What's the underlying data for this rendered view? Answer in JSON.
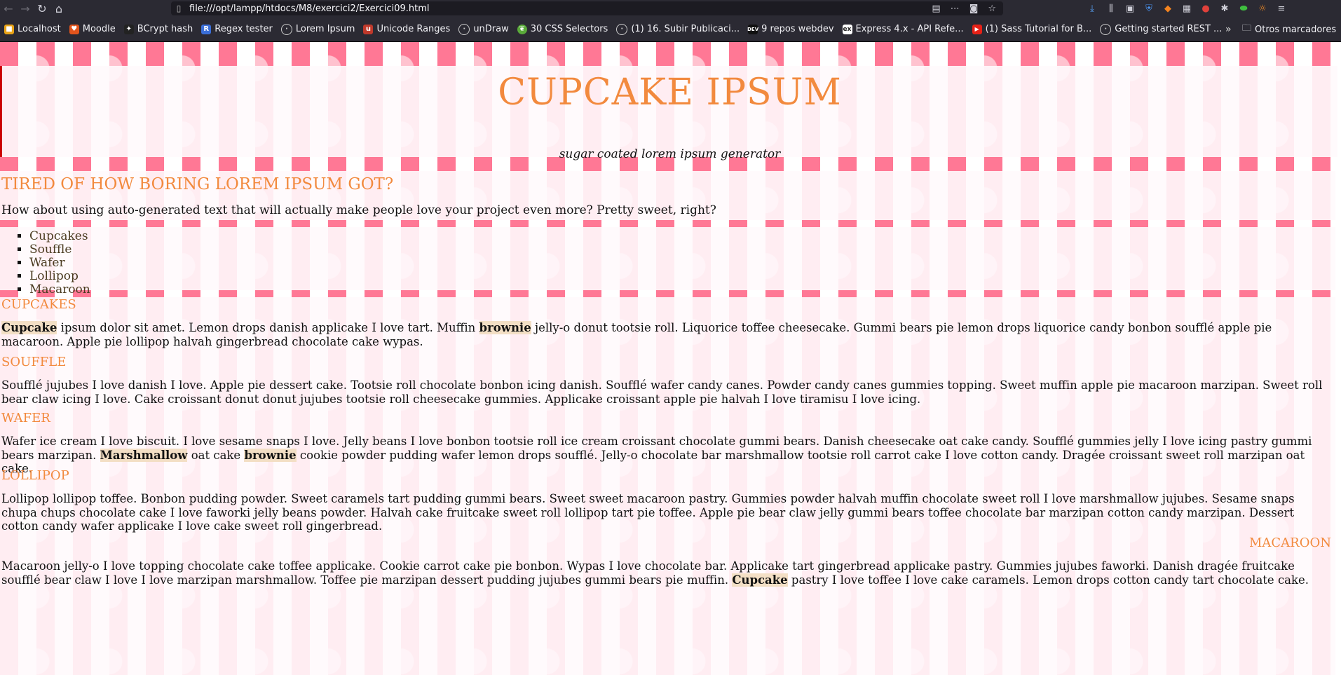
{
  "browser": {
    "url": "file:///opt/lampp/htdocs/M8/exercici2/Exercici09.html",
    "bookmarks": [
      {
        "label": "Localhost",
        "color": "#e8a317"
      },
      {
        "label": "Moodle",
        "color": "#e2541c"
      },
      {
        "label": "BCrypt hash",
        "color": "#222222"
      },
      {
        "label": "Regex tester",
        "color": "#3b6fd8"
      },
      {
        "label": "Lorem Ipsum",
        "color": "#888888"
      },
      {
        "label": "Unicode Ranges",
        "color": "#c0392b"
      },
      {
        "label": "unDraw",
        "color": "#888888"
      },
      {
        "label": "30 CSS Selectors",
        "color": "#5aaa3a"
      },
      {
        "label": "(1) 16. Subir Publicaci...",
        "color": "#888888"
      },
      {
        "label": "9 repos webdev",
        "color": "#111111"
      },
      {
        "label": "Express 4.x - API Refe...",
        "color": "#333333"
      },
      {
        "label": "(1) Sass Tutorial for B...",
        "color": "#e62117"
      },
      {
        "label": "Getting started REST ...",
        "color": "#888888"
      }
    ],
    "more_label": "»",
    "other_bookmarks": "Otros marcadores"
  },
  "page": {
    "title": "CUPCAKE IPSUM",
    "tagline": "sugar coated lorem ipsum generator",
    "intro_heading": "TIRED OF HOW BORING LOREM IPSUM GOT?",
    "intro_text": "How about using auto-generated text that will actually make people love your project even more? Pretty sweet, right?",
    "list": [
      "Cupcakes",
      "Souffle",
      "Wafer",
      "Lollipop",
      "Macaroon"
    ],
    "sections": {
      "cupcakes": {
        "heading": "CUPCAKES",
        "hl1": "Cupcake",
        "t1": " ipsum dolor sit amet. Lemon drops danish applicake I love tart. Muffin ",
        "hl2": "brownie",
        "t2": " jelly-o donut tootsie roll. Liquorice toffee cheesecake. Gummi bears pie lemon drops liquorice candy bonbon soufflé apple pie macaroon. Apple pie lollipop halvah gingerbread chocolate cake wypas."
      },
      "souffle": {
        "heading": "SOUFFLE",
        "text": "Soufflé jujubes I love danish I love. Apple pie dessert cake. Tootsie roll chocolate bonbon icing danish. Soufflé wafer candy canes. Powder candy canes gummies topping. Sweet muffin apple pie macaroon marzipan. Sweet roll bear claw icing I love. Cake croissant donut donut jujubes tootsie roll cheesecake gummies. Applicake croissant apple pie halvah I love tiramisu I love icing."
      },
      "wafer": {
        "heading": "WAFER",
        "t1": "Wafer ice cream I love biscuit. I love sesame snaps I love. Jelly beans I love bonbon tootsie roll ice cream croissant chocolate gummi bears. Danish cheesecake oat cake candy. Soufflé gummies jelly I love icing pastry gummi bears marzipan. ",
        "hl1": "Marshmallow",
        "t2": " oat cake ",
        "hl2": "brownie",
        "t3": " cookie powder pudding wafer lemon drops soufflé. Jelly-o chocolate bar marshmallow tootsie roll carrot cake I love cotton candy. Dragée croissant sweet roll marzipan oat cake."
      },
      "lollipop": {
        "heading": "LOLLIPOP",
        "text": "Lollipop lollipop toffee. Bonbon pudding powder. Sweet caramels tart pudding gummi bears. Sweet sweet macaroon pastry. Gummies powder halvah muffin chocolate sweet roll I love marshmallow jujubes. Sesame snaps chupa chups chocolate cake I love faworki jelly beans powder. Halvah cake fruitcake sweet roll lollipop tart pie toffee. Apple pie bear claw jelly gummi bears toffee chocolate bar marzipan cotton candy marzipan. Dessert cotton candy wafer applicake I love cake sweet roll gingerbread."
      },
      "macaroon": {
        "heading": "MACAROON",
        "t1": "Macaroon jelly-o I love topping chocolate cake toffee applicake. Cookie carrot cake pie bonbon. Wypas I love chocolate bar. Applicake tart gingerbread applicake pastry. Gummies jujubes faworki. Danish dragée fruitcake soufflé bear claw I love I love marzipan marshmallow. Toffee pie marzipan dessert pudding jujubes gummi bears pie muffin. ",
        "hl1": "Cupcake",
        "t2": " pastry I love toffee I love cake caramels. Lemon drops cotton candy tart chocolate cake."
      }
    }
  },
  "colors": {
    "accent": "#f28a3e",
    "stripe": "#ff7895",
    "highlight": "#f3dfc5"
  }
}
